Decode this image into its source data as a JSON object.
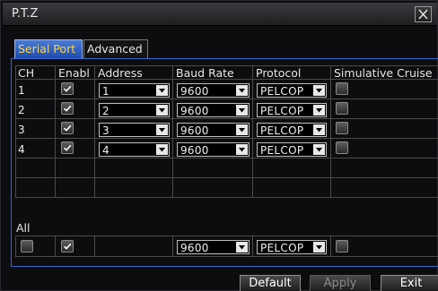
{
  "window": {
    "title": "P.T.Z"
  },
  "tabs": [
    {
      "label": "Serial Port",
      "active": true
    },
    {
      "label": "Advanced",
      "active": false
    }
  ],
  "table": {
    "headers": [
      "CH",
      "Enabl",
      "Address",
      "Baud Rate",
      "Protocol",
      "Simulative Cruise"
    ],
    "rows": [
      {
        "ch": "1",
        "enabled": true,
        "address": "1",
        "baud": "9600",
        "protocol": "PELCOP",
        "cruise": false
      },
      {
        "ch": "2",
        "enabled": true,
        "address": "2",
        "baud": "9600",
        "protocol": "PELCOP",
        "cruise": false
      },
      {
        "ch": "3",
        "enabled": true,
        "address": "3",
        "baud": "9600",
        "protocol": "PELCOP",
        "cruise": false
      },
      {
        "ch": "4",
        "enabled": true,
        "address": "4",
        "baud": "9600",
        "protocol": "PELCOP",
        "cruise": false
      }
    ]
  },
  "all": {
    "label": "All",
    "checked": false,
    "enabled": true,
    "baud": "9600",
    "protocol": "PELCOP",
    "cruise": false
  },
  "buttons": {
    "default": "Default",
    "apply": "Apply",
    "exit": "Exit"
  },
  "colors": {
    "accent": "#2f5fcf",
    "active_tab_text": "#ffd43a",
    "border": "#3b67c8"
  },
  "icons": {
    "close": "close-icon",
    "dropdown": "chevron-down-icon",
    "check": "check-icon"
  }
}
